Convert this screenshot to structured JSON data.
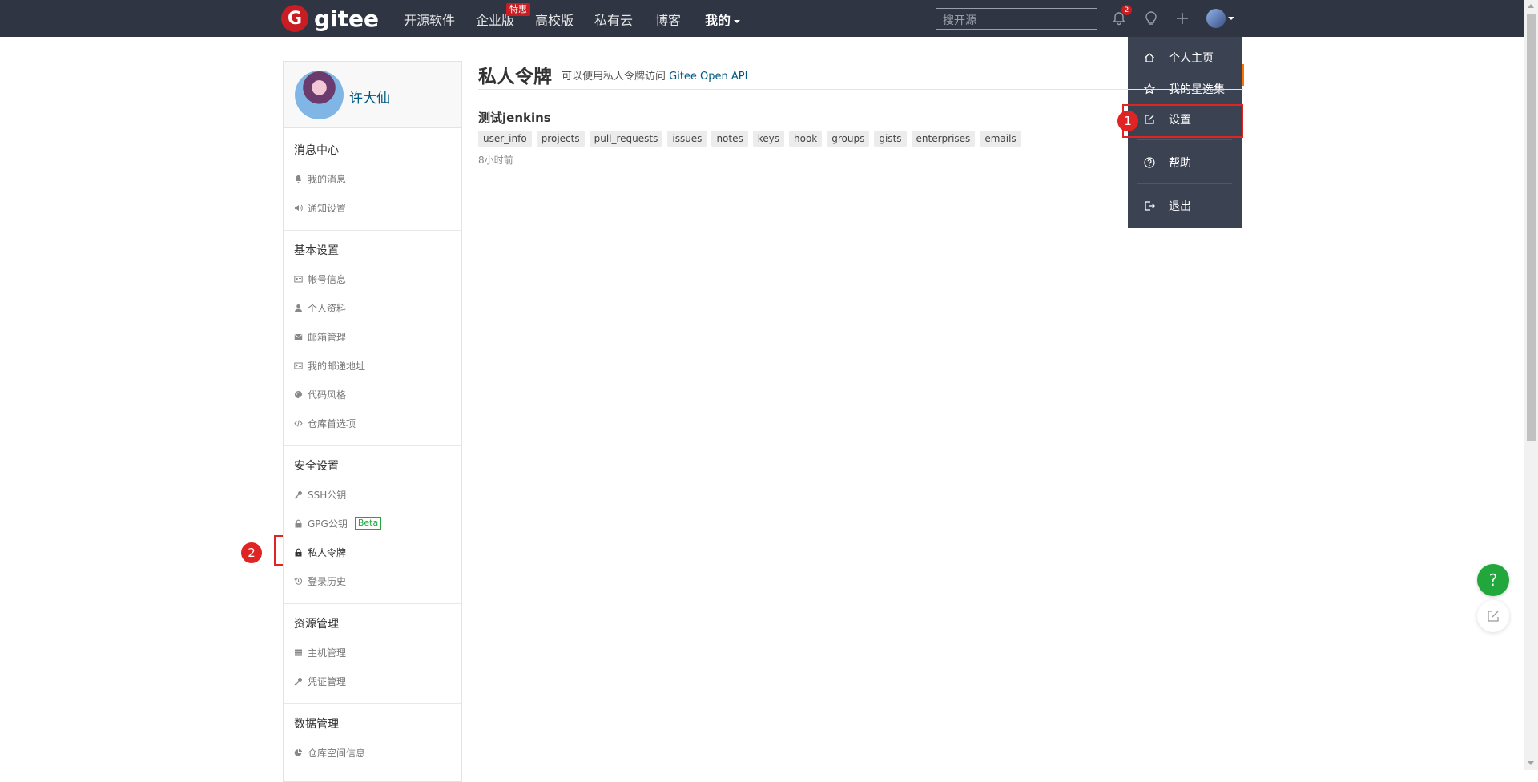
{
  "navbar": {
    "logo_text": "gitee",
    "logo_mark": "G",
    "items": [
      {
        "label": "开源软件"
      },
      {
        "label": "企业版"
      },
      {
        "label": "高校版"
      },
      {
        "label": "私有云"
      },
      {
        "label": "博客"
      },
      {
        "label": "我的"
      }
    ],
    "promo_badge": "特惠",
    "search_placeholder": "搜开源",
    "notification_count": "2",
    "icons": [
      "bell-icon",
      "lightbulb-icon",
      "plus-icon",
      "avatar"
    ]
  },
  "dropdown": {
    "items": [
      {
        "label": "个人主页",
        "icon": "home-icon"
      },
      {
        "label": "我的星选集",
        "icon": "star-icon"
      },
      {
        "label": "设置",
        "icon": "edit-icon"
      },
      {
        "label": "帮助",
        "icon": "question-circle-icon"
      },
      {
        "label": "退出",
        "icon": "logout-icon"
      }
    ]
  },
  "annotations": {
    "step1": "1",
    "step2": "2"
  },
  "sidebar": {
    "user_name": "许大仙",
    "groups": [
      {
        "title": "消息中心",
        "items": [
          {
            "label": "我的消息",
            "icon": "bell-icon"
          },
          {
            "label": "通知设置",
            "icon": "speaker-icon"
          }
        ]
      },
      {
        "title": "基本设置",
        "items": [
          {
            "label": "帐号信息",
            "icon": "id-card-icon"
          },
          {
            "label": "个人资料",
            "icon": "user-icon"
          },
          {
            "label": "邮箱管理",
            "icon": "envelope-icon"
          },
          {
            "label": "我的邮递地址",
            "icon": "address-card-icon"
          },
          {
            "label": "代码风格",
            "icon": "palette-icon"
          },
          {
            "label": "仓库首选项",
            "icon": "code-icon"
          }
        ]
      },
      {
        "title": "安全设置",
        "items": [
          {
            "label": "SSH公钥",
            "icon": "key-icon"
          },
          {
            "label": "GPG公钥",
            "icon": "lock-icon",
            "badge": "Beta"
          },
          {
            "label": "私人令牌",
            "icon": "token-icon",
            "active": true
          },
          {
            "label": "登录历史",
            "icon": "history-icon"
          }
        ]
      },
      {
        "title": "资源管理",
        "items": [
          {
            "label": "主机管理",
            "icon": "server-icon"
          },
          {
            "label": "凭证管理",
            "icon": "key-icon"
          }
        ]
      },
      {
        "title": "数据管理",
        "items": [
          {
            "label": "仓库空间信息",
            "icon": "pie-icon"
          }
        ]
      }
    ]
  },
  "main": {
    "title": "私人令牌",
    "subtitle_prefix": "可以使用私人令牌访问 ",
    "subtitle_link": "Gitee Open API",
    "token": {
      "name": "测试jenkins",
      "scopes": [
        "user_info",
        "projects",
        "pull_requests",
        "issues",
        "notes",
        "keys",
        "hook",
        "groups",
        "gists",
        "enterprises",
        "emails"
      ],
      "time": "8小时前"
    }
  },
  "floating": {
    "help_label": "?"
  },
  "colors": {
    "navbar_bg": "#2f3542",
    "brand_red": "#c71d23",
    "link_blue": "#005980",
    "annotation_red": "#e02424",
    "help_green": "#21a73c"
  }
}
